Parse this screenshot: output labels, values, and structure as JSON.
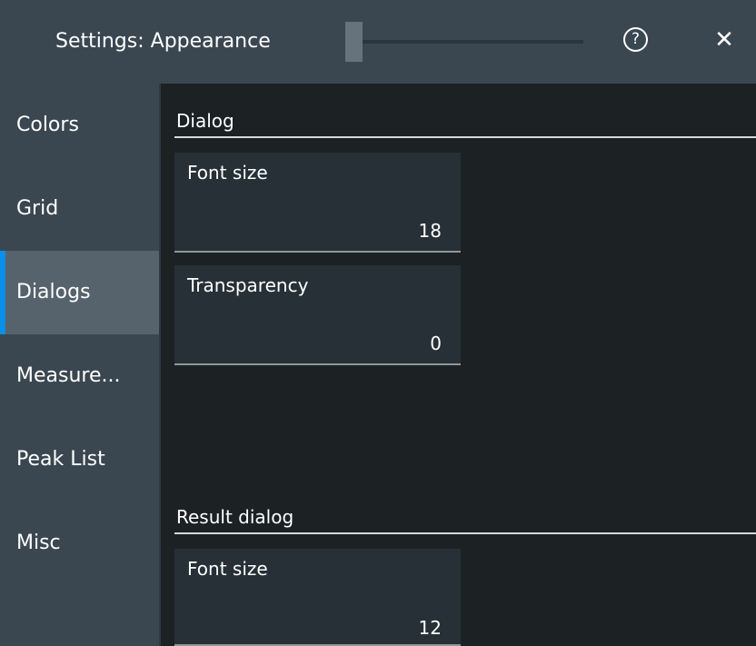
{
  "header": {
    "title": "Settings: Appearance",
    "opacity_slider": {
      "value": 0
    },
    "help_icon": "help-icon",
    "help_glyph": "?",
    "close_icon": "close-icon",
    "close_glyph": "✕"
  },
  "sidebar": {
    "items": [
      {
        "label": "Colors",
        "active": false
      },
      {
        "label": "Grid",
        "active": false
      },
      {
        "label": "Dialogs",
        "active": true
      },
      {
        "label": "Measure...",
        "active": false
      },
      {
        "label": "Peak List",
        "active": false
      },
      {
        "label": "Misc",
        "active": false
      }
    ]
  },
  "main": {
    "dialog_section": {
      "title": "Dialog",
      "font_size": {
        "label": "Font size",
        "value": "18"
      },
      "transparency": {
        "label": "Transparency",
        "value": "0"
      }
    },
    "result_dialog_section": {
      "title": "Result dialog",
      "font_size": {
        "label": "Font size",
        "value": "12"
      }
    }
  },
  "colors": {
    "titlebar_bg": "#3a4751",
    "sidebar_bg": "#3a4751",
    "sidebar_active_bg": "#56636c",
    "accent": "#0a90e8",
    "content_bg": "#1c2124",
    "field_bg": "#263036"
  }
}
